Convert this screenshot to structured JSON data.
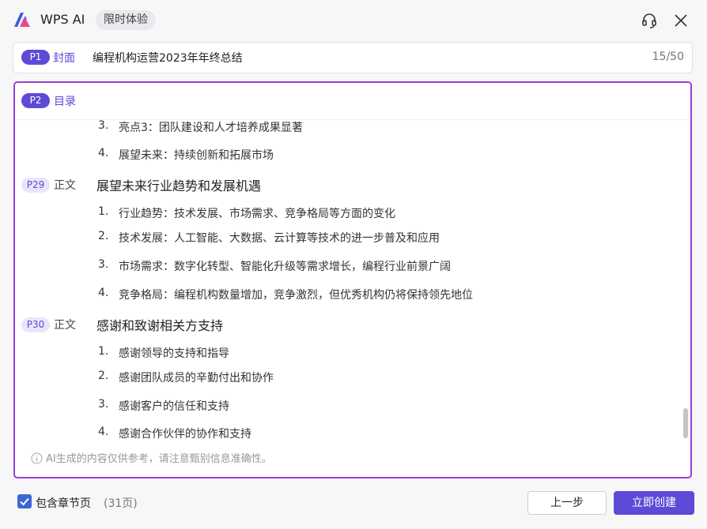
{
  "header": {
    "app_title": "WPS AI",
    "trial_badge": "限时体验"
  },
  "cover": {
    "page_label": "P1",
    "type_label": "封面",
    "title_value": "编程机构运营2023年年终总结",
    "counter": "15/50"
  },
  "outline": {
    "sticky_section": {
      "page_label": "P2",
      "type_label": "目录"
    },
    "toc_items": [
      {
        "num": "3.",
        "text": "亮点3：团队建设和人才培养成果显著"
      },
      {
        "num": "4.",
        "text": "展望未来：持续创新和拓展市场"
      }
    ],
    "sections": [
      {
        "page_label": "P29",
        "type_label": "正文",
        "title": "展望未来行业趋势和发展机遇",
        "items": [
          {
            "num": "1.",
            "text": "行业趋势：技术发展、市场需求、竞争格局等方面的变化"
          },
          {
            "num": "2.",
            "text": "技术发展：人工智能、大数据、云计算等技术的进一步普及和应用"
          },
          {
            "num": "3.",
            "text": "市场需求：数字化转型、智能化升级等需求增长，编程行业前景广阔"
          },
          {
            "num": "4.",
            "text": "竞争格局：编程机构数量增加，竞争激烈，但优秀机构仍将保持领先地位"
          }
        ]
      },
      {
        "page_label": "P30",
        "type_label": "正文",
        "title": "感谢和致谢相关方支持",
        "items": [
          {
            "num": "1.",
            "text": "感谢领导的支持和指导"
          },
          {
            "num": "2.",
            "text": "感谢团队成员的辛勤付出和协作"
          },
          {
            "num": "3.",
            "text": "感谢客户的信任和支持"
          },
          {
            "num": "4.",
            "text": "感谢合作伙伴的协作和支持"
          }
        ]
      }
    ],
    "disclaimer": "AI生成的内容仅供参考，请注意甄别信息准确性。"
  },
  "footer": {
    "include_chapters_label": "包含章节页",
    "include_chapters_checked": true,
    "page_count": "(31页)",
    "prev_button": "上一步",
    "create_button": "立即创建"
  },
  "colors": {
    "accent": "#5d4ad6",
    "focus_border": "#9b3fd8",
    "checkbox": "#3a66d6"
  },
  "icons": {
    "logo": "wps-ai-logo",
    "headset": "headset-icon",
    "close": "close-icon",
    "info": "info-icon",
    "checkbox": "checkbox-checked-icon"
  }
}
